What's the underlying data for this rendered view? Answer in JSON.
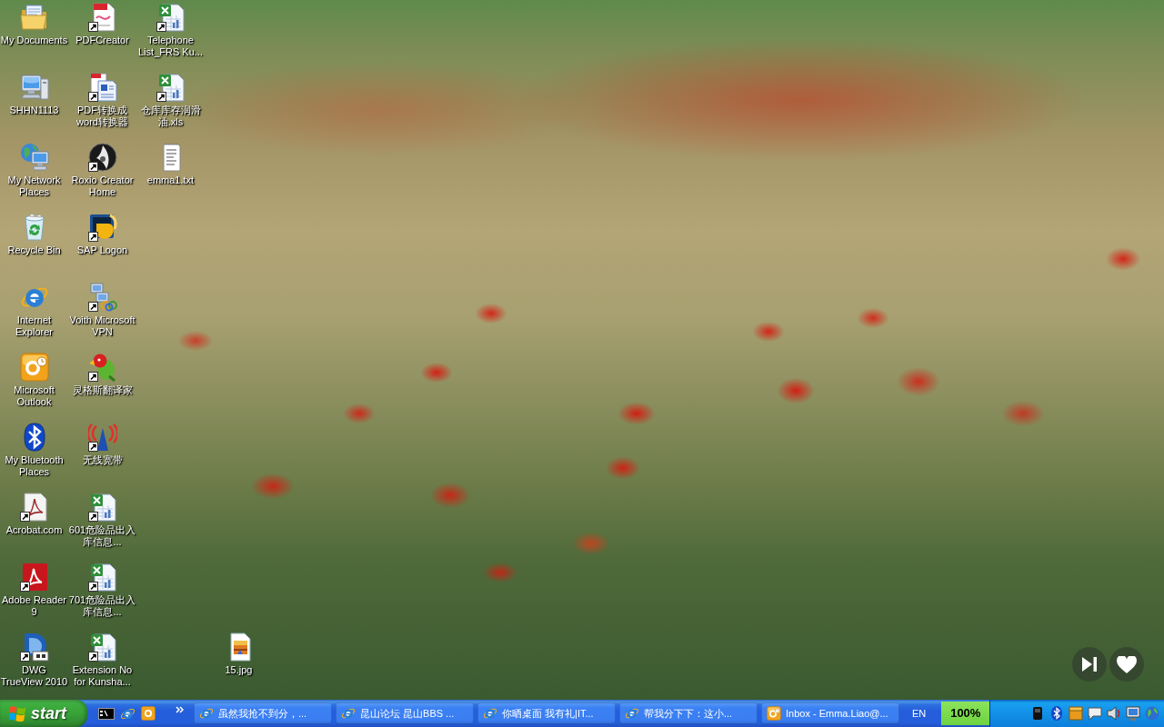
{
  "desktop": {
    "icon_columns": [
      {
        "icons": [
          {
            "label": "My Documents",
            "kind": "folder",
            "shortcut": false
          },
          {
            "label": "SHHN1113",
            "kind": "computer",
            "shortcut": false
          },
          {
            "label": "My Network Places",
            "kind": "network",
            "shortcut": false
          },
          {
            "label": "Recycle Bin",
            "kind": "recycle",
            "shortcut": false
          },
          {
            "label": "Internet Explorer",
            "kind": "browser",
            "shortcut": false
          },
          {
            "label": "Microsoft Outlook",
            "kind": "mail",
            "shortcut": false
          },
          {
            "label": "My Bluetooth Places",
            "kind": "bluetooth",
            "shortcut": false
          },
          {
            "label": "Acrobat.com",
            "kind": "acrobat",
            "shortcut": true
          },
          {
            "label": "Adobe Reader 9",
            "kind": "reader",
            "shortcut": true
          },
          {
            "label": "DWG TrueView 2010",
            "kind": "cad",
            "shortcut": true
          }
        ]
      },
      {
        "icons": [
          {
            "label": "PDFCreator",
            "kind": "pdf",
            "shortcut": true
          },
          {
            "label": "PDF转换成word转换器",
            "kind": "converter",
            "shortcut": true
          },
          {
            "label": "Roxio Creator Home",
            "kind": "disc",
            "shortcut": true
          },
          {
            "label": "SAP Logon",
            "kind": "logon",
            "shortcut": true
          },
          {
            "label": "Voith Microsoft VPN",
            "kind": "vpn",
            "shortcut": true
          },
          {
            "label": "灵格斯翻译家",
            "kind": "parrot",
            "shortcut": true
          },
          {
            "label": "无线宽带",
            "kind": "antenna",
            "shortcut": true
          },
          {
            "label": "601危险品出入库信息...",
            "kind": "spreadsheet",
            "shortcut": true
          },
          {
            "label": "701危险品出入库信息...",
            "kind": "spreadsheet",
            "shortcut": true
          },
          {
            "label": "Extension No for Kunsha...",
            "kind": "spreadsheet",
            "shortcut": true
          }
        ]
      },
      {
        "icons": [
          {
            "label": "Telephone List_FRS Ku...",
            "kind": "spreadsheet",
            "shortcut": true
          },
          {
            "label": "仓库库存润滑油.xls",
            "kind": "spreadsheet",
            "shortcut": true
          },
          {
            "label": "emma1.txt",
            "kind": "text",
            "shortcut": false
          }
        ]
      },
      {
        "icons": [
          {
            "label": "15.jpg",
            "kind": "image",
            "shortcut": false
          }
        ]
      }
    ]
  },
  "taskbar": {
    "start_label": "start",
    "tasks": [
      {
        "title": "虽然我抢不到分，...",
        "kind": "browser",
        "selected": false
      },
      {
        "title": "昆山论坛 昆山BBS ...",
        "kind": "browser",
        "selected": false
      },
      {
        "title": "你晒桌面 我有礼|IT...",
        "kind": "browser",
        "selected": false
      },
      {
        "title": "帮我分下下：这小...",
        "kind": "browser",
        "selected": false
      },
      {
        "title": "Inbox - Emma.Liao@...",
        "kind": "mail",
        "selected": false
      }
    ],
    "language": "EN",
    "percent_reading": "100%"
  }
}
